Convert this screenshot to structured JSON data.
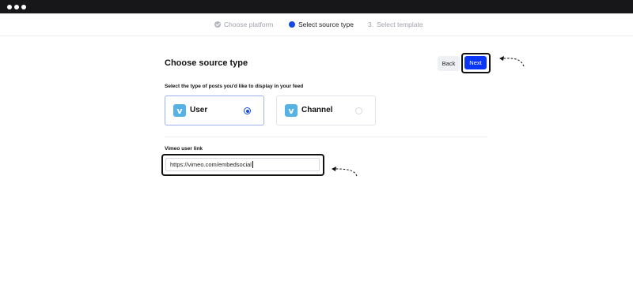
{
  "window": {
    "dots": 3
  },
  "stepper": {
    "steps": [
      {
        "label": "Choose platform",
        "status": "done"
      },
      {
        "label": "Select source type",
        "status": "current"
      },
      {
        "label": "Select template",
        "number": "3.",
        "status": "upcoming"
      }
    ]
  },
  "header": {
    "title": "Choose source type",
    "back_label": "Back",
    "next_label": "Next"
  },
  "section": {
    "subtitle": "Select the type of posts you'd like to display in your feed"
  },
  "options": [
    {
      "label": "User",
      "icon": "vimeo-logo-icon",
      "selected": true
    },
    {
      "label": "Channel",
      "icon": "vimeo-logo-icon",
      "selected": false
    }
  ],
  "field": {
    "label": "Vimeo user link",
    "value": "https://vimeo.com/embedsocial"
  },
  "colors": {
    "accent": "#0a36f5",
    "vimeo": "#56b1e5",
    "topbar": "#17171a"
  }
}
